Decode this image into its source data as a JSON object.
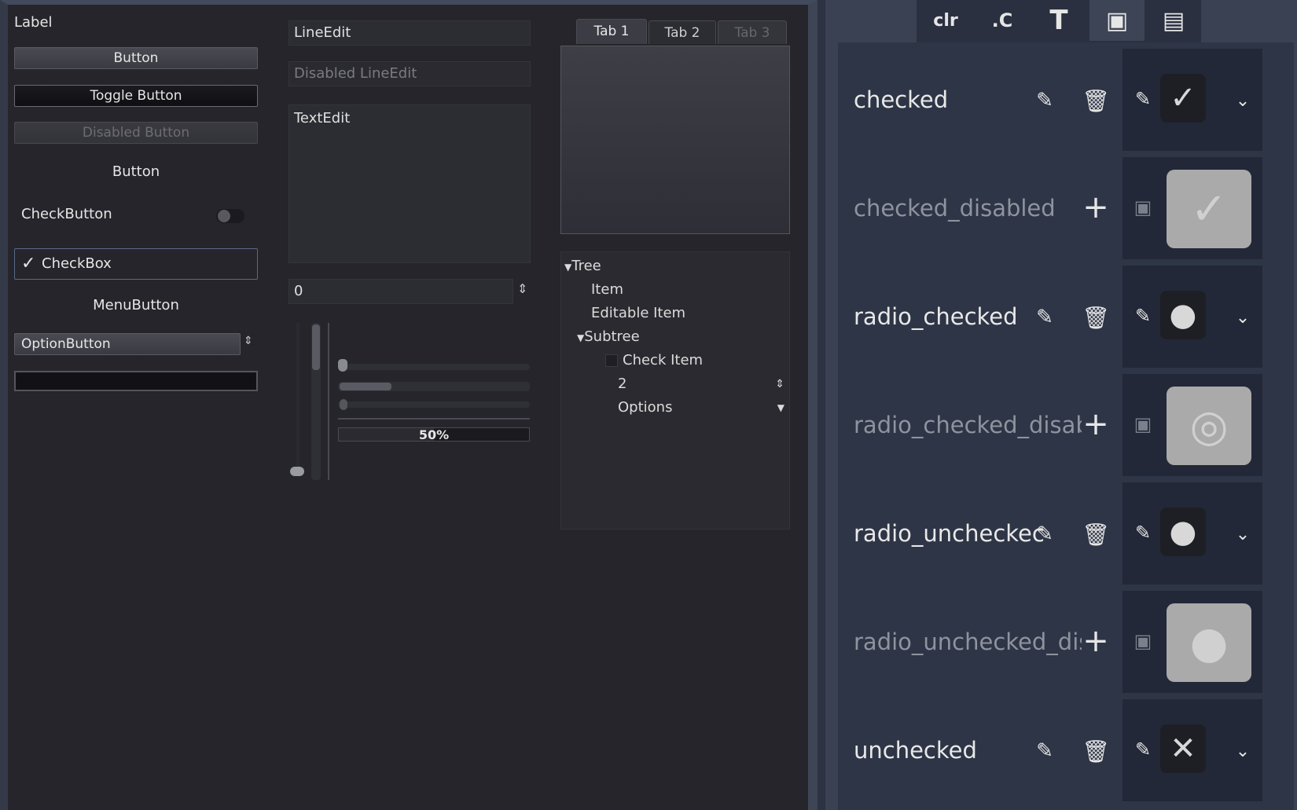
{
  "preview": {
    "label": "Label",
    "button": "Button",
    "toggle_button": "Toggle Button",
    "disabled_button": "Disabled Button",
    "flat_button": "Button",
    "check_button": "CheckButton",
    "checkbox": "CheckBox",
    "menu_button": "MenuButton",
    "option_button": "OptionButton",
    "line_edit": "LineEdit",
    "disabled_line_edit": "Disabled LineEdit",
    "text_edit": "TextEdit",
    "spinbox_value": "0",
    "progress": "50%",
    "progress_value": 0.5,
    "tabs": [
      "Tab 1",
      "Tab 2",
      "Tab 3"
    ],
    "tree": {
      "root": "Tree",
      "item": "Item",
      "editable_item": "Editable Item",
      "subtree": "Subtree",
      "check_item": "Check Item",
      "range_value": "2",
      "options": "Options"
    }
  },
  "panel": {
    "tabs": [
      {
        "icon": "color-icon",
        "glyph": "clr"
      },
      {
        "icon": "constant-icon",
        "glyph": ".C"
      },
      {
        "icon": "font-icon",
        "glyph": "T"
      },
      {
        "icon": "texture-icon",
        "glyph": "▣"
      },
      {
        "icon": "stylebox-icon",
        "glyph": "▤"
      }
    ],
    "rows": [
      {
        "name": "checked",
        "state": "set"
      },
      {
        "name": "checked_disabled",
        "state": "unset"
      },
      {
        "name": "radio_checked",
        "state": "set"
      },
      {
        "name": "radio_checked_disabl",
        "state": "unset"
      },
      {
        "name": "radio_uncheckec",
        "state": "set"
      },
      {
        "name": "radio_unchecked_disa",
        "state": "unset"
      },
      {
        "name": "unchecked",
        "state": "set"
      }
    ]
  }
}
